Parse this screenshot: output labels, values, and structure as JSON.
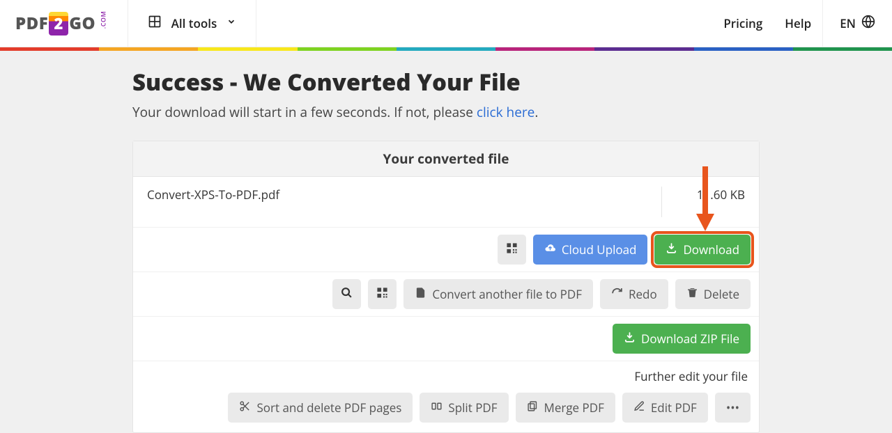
{
  "header": {
    "logo_left": "PDF",
    "logo_num": "2",
    "logo_right": "GO",
    "logo_com": ".COM",
    "alltools": "All tools",
    "pricing": "Pricing",
    "help": "Help",
    "lang": "EN"
  },
  "rainbow": [
    "#e33d2b",
    "#f5a623",
    "#f8e71c",
    "#7ed321",
    "#24aabf",
    "#b8247b",
    "#5c2d91",
    "#2a61c4",
    "#20944e"
  ],
  "page": {
    "title": "Success - We Converted Your File",
    "subtitle_pre": "Your download will start in a few seconds. If not, please ",
    "subtitle_link": "click here",
    "subtitle_post": "."
  },
  "panel": {
    "header": "Your converted file",
    "file_name": "Convert-XPS-To-PDF.pdf",
    "file_size": "11.60 KB"
  },
  "buttons": {
    "cloud_upload": "Cloud Upload",
    "download": "Download",
    "convert_another": "Convert another file to PDF",
    "redo": "Redo",
    "delete": "Delete",
    "download_zip": "Download ZIP File",
    "further_edit": "Further edit your file",
    "sort_delete": "Sort and delete PDF pages",
    "split_pdf": "Split PDF",
    "merge_pdf": "Merge PDF",
    "edit_pdf": "Edit PDF",
    "more": "•••"
  }
}
